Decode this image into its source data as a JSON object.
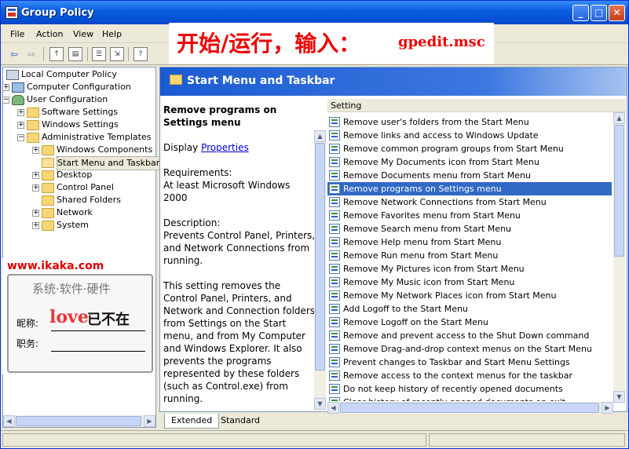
{
  "window": {
    "title": "Group Policy",
    "min": "_",
    "max": "□",
    "close": "✕"
  },
  "menu": [
    "File",
    "Action",
    "View",
    "Help"
  ],
  "overlay": {
    "chinese": "开始/运行，输入：",
    "command": "gpedit.msc"
  },
  "tree": [
    {
      "label": "Local Computer Policy",
      "icon": "local-computer-policy-icon",
      "depth": 0,
      "expander": ""
    },
    {
      "label": "Computer Configuration",
      "icon": "computer-icon",
      "depth": 1,
      "expander": "+"
    },
    {
      "label": "User Configuration",
      "icon": "user-icon",
      "depth": 1,
      "expander": "−"
    },
    {
      "label": "Software Settings",
      "icon": "folder-icon",
      "depth": 2,
      "expander": "+"
    },
    {
      "label": "Windows Settings",
      "icon": "folder-icon",
      "depth": 2,
      "expander": "+"
    },
    {
      "label": "Administrative Templates",
      "icon": "folder-icon",
      "depth": 2,
      "expander": "−"
    },
    {
      "label": "Windows Components",
      "icon": "folder-icon",
      "depth": 3,
      "expander": "+"
    },
    {
      "label": "Start Menu and Taskbar",
      "icon": "open-folder-icon",
      "depth": 3,
      "expander": "",
      "selected": true
    },
    {
      "label": "Desktop",
      "icon": "folder-icon",
      "depth": 3,
      "expander": "+"
    },
    {
      "label": "Control Panel",
      "icon": "folder-icon",
      "depth": 3,
      "expander": "+"
    },
    {
      "label": "Shared Folders",
      "icon": "folder-icon",
      "depth": 3,
      "expander": ""
    },
    {
      "label": "Network",
      "icon": "folder-icon",
      "depth": 3,
      "expander": "+"
    },
    {
      "label": "System",
      "icon": "folder-icon",
      "depth": 3,
      "expander": "+"
    }
  ],
  "ad": {
    "url": "www.ikaka.com",
    "subtitle": "系统·软件·硬件",
    "nickname_label": "昵称:",
    "title_label": "职务:",
    "love": "love",
    "zai": "已不在"
  },
  "banner": {
    "title": "Start Menu and Taskbar"
  },
  "description": {
    "title": "Remove programs on Settings menu",
    "display_prefix": "Display",
    "display_link": "Properties",
    "requirements_label": "Requirements:",
    "requirements": "At least Microsoft Windows 2000",
    "description_label": "Description:",
    "description_text": "Prevents Control Panel, Printers, and Network Connections from running.",
    "body": "This setting removes the Control Panel, Printers, and Network and Connection folders from Settings on the Start menu, and from My Computer and Windows Explorer. It also prevents the programs represented by these folders (such as Control.exe) from running."
  },
  "list": {
    "header": "Setting",
    "items": [
      "Remove user's folders from the Start Menu",
      "Remove links and access to Windows Update",
      "Remove common program groups from Start Menu",
      "Remove My Documents icon from Start Menu",
      "Remove Documents menu from Start Menu",
      "Remove programs on Settings menu",
      "Remove Network Connections from Start Menu",
      "Remove Favorites menu from Start Menu",
      "Remove Search menu from Start Menu",
      "Remove Help menu from Start Menu",
      "Remove Run menu from Start Menu",
      "Remove My Pictures icon from Start Menu",
      "Remove My Music icon from Start Menu",
      "Remove My Network Places icon from Start Menu",
      "Add Logoff to the Start Menu",
      "Remove Logoff on the Start Menu",
      "Remove and prevent access to the Shut Down command",
      "Remove Drag-and-drop context menus on the Start Menu",
      "Prevent changes to Taskbar and Start Menu Settings",
      "Remove access to the context menus for the taskbar",
      "Do not keep history of recently opened documents",
      "Clear history of recently opened documents on exit"
    ],
    "selected_index": 5
  },
  "tabs": [
    "Extended",
    "Standard"
  ]
}
